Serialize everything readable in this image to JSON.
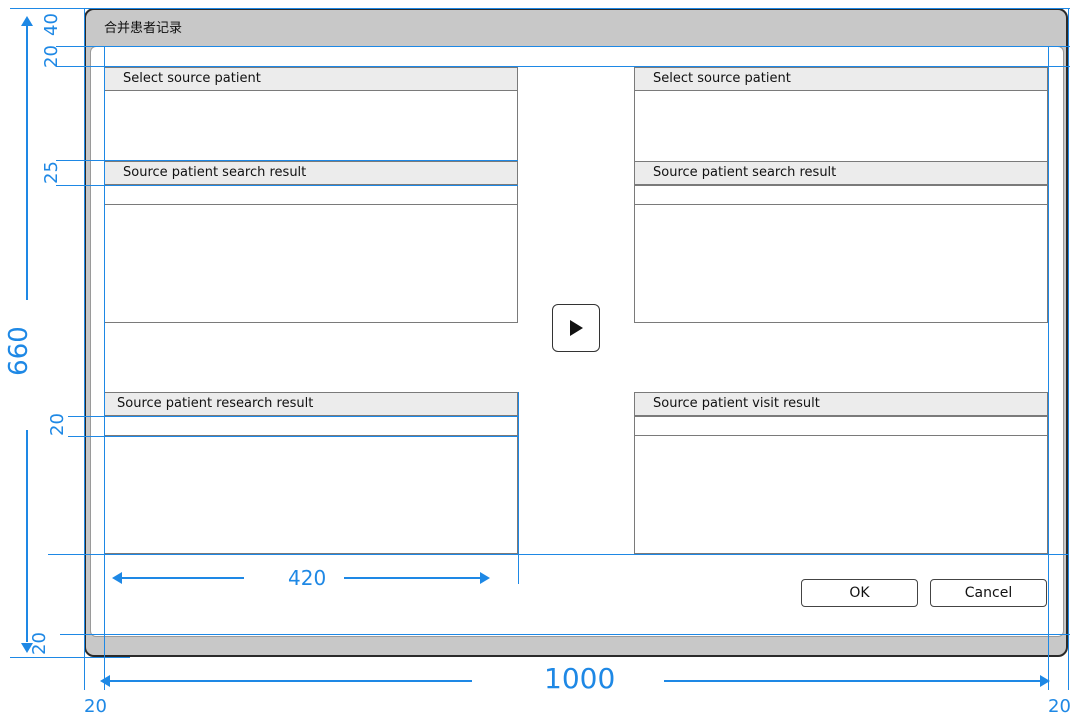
{
  "window": {
    "title": "合并患者记录"
  },
  "panels": {
    "left_select": "Select source patient",
    "left_search": "Source patient search result",
    "left_research": "Source patient research result",
    "right_select": "Select source patient",
    "right_search": "Source patient search result",
    "right_visit": "Source patient visit result"
  },
  "buttons": {
    "ok": "OK",
    "cancel": "Cancel"
  },
  "dimensions": {
    "top_40": "40",
    "top_20": "20",
    "mid_25": "25",
    "height_660": "660",
    "mid_20": "20",
    "bottom_20": "20",
    "panel_width_420": "420",
    "total_width_1000": "1000",
    "left_margin_20": "20",
    "right_margin_20": "20"
  },
  "colors": {
    "annotation": "#1e88e5",
    "title_bar": "#c8c8c8",
    "header": "#ececec"
  }
}
